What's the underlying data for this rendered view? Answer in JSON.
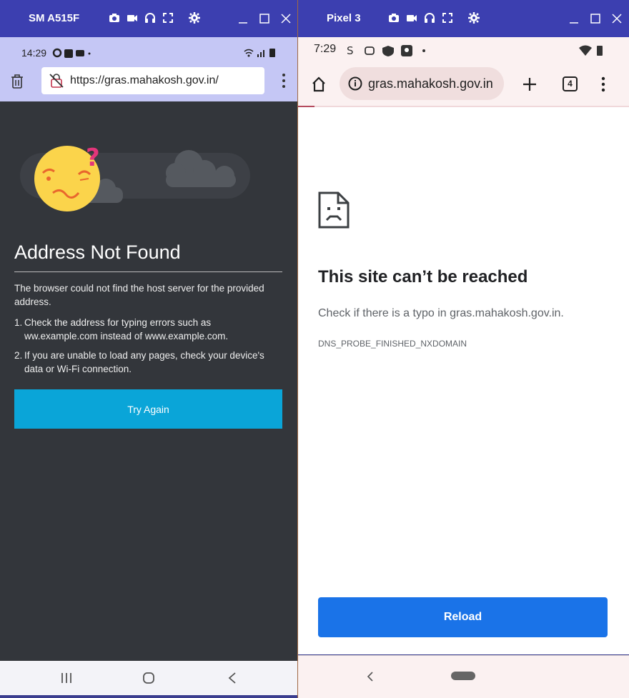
{
  "left_device": {
    "title": "SM A515F",
    "status_time": "14:29",
    "url": "https://gras.mahakosh.gov.in/",
    "error": {
      "heading": "Address Not Found",
      "description": "The browser could not find the host server for the provided address.",
      "tips": [
        {
          "num": "1.",
          "text": "Check the address for typing errors such as ww.example.com instead of www.example.com."
        },
        {
          "num": "2.",
          "text": "If you are unable to load any pages, check your device's data or Wi-Fi connection."
        }
      ],
      "button": "Try Again"
    },
    "colors": {
      "titlebar": "#3c3fb0",
      "toolbar": "#c5c7f5",
      "page_bg": "#33363b",
      "button": "#0aa5d8"
    },
    "icons": [
      "camera-icon",
      "video-icon",
      "headphones-icon",
      "fullscreen-icon",
      "settings-icon",
      "trash-icon",
      "no-lock-icon",
      "more-vert-icon",
      "wifi-icon",
      "signal-icon",
      "battery-icon",
      "recents-icon",
      "home-icon",
      "back-icon",
      "confused-emoji-icon",
      "cloud-icon"
    ]
  },
  "right_device": {
    "title": "Pixel 3",
    "status_time": "7:29",
    "url": "gras.mahakosh.gov.in",
    "tab_count": "4",
    "page_load_progress": 0.05,
    "error": {
      "heading": "This site can’t be reached",
      "message": "Check if there is a typo in gras.mahakosh.gov.in.",
      "code": "DNS_PROBE_FINISHED_NXDOMAIN",
      "button": "Reload"
    },
    "colors": {
      "titlebar": "#3c3fb0",
      "toolbar": "#fbf1f1",
      "urlbox": "#f0dede",
      "button": "#1a73e8",
      "progress": "#b54b5e"
    },
    "icons": [
      "camera-icon",
      "video-icon",
      "headphones-icon",
      "fullscreen-icon",
      "settings-icon",
      "home-icon",
      "info-icon",
      "plus-icon",
      "tabs-icon",
      "more-vert-icon",
      "wifi-icon",
      "battery-icon",
      "sad-document-icon",
      "back-icon",
      "home-pill-icon"
    ]
  }
}
